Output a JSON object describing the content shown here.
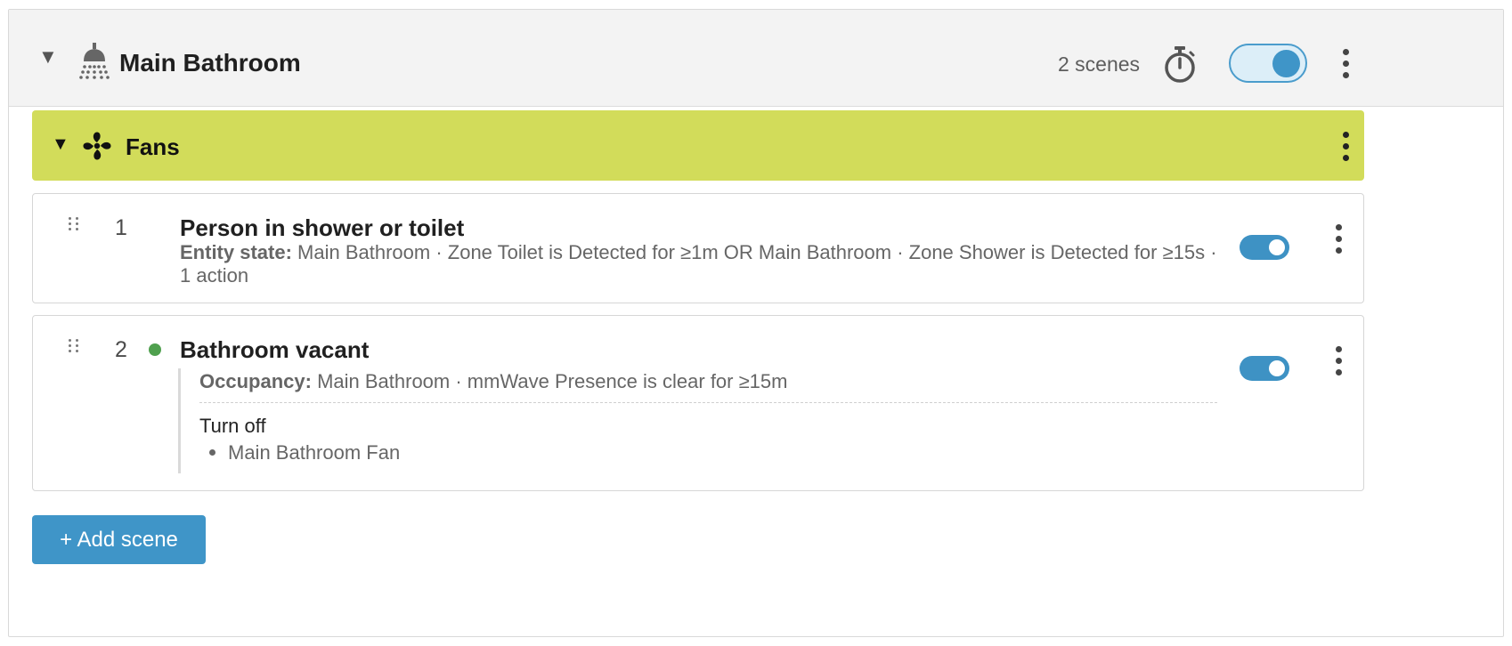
{
  "room": {
    "title": "Main Bathroom",
    "scene_count": "2 scenes",
    "enabled": true
  },
  "group": {
    "title": "Fans",
    "color": "#d2dc5a"
  },
  "scenes": [
    {
      "number": "1",
      "name": "Person in shower or toilet",
      "desc_label": "Entity state:",
      "desc_text": "Main Bathroom · Zone Toilet is Detected for ≥1m OR Main Bathroom · Zone Shower is Detected for ≥15s · 1 action",
      "enabled": true
    },
    {
      "number": "2",
      "name": "Bathroom vacant",
      "status_color": "#4fa04e",
      "condition_label": "Occupancy:",
      "condition_text": "Main Bathroom · mmWave Presence is clear for ≥15m",
      "action_title": "Turn off",
      "action_items": [
        "Main Bathroom Fan"
      ],
      "enabled": true
    }
  ],
  "add_button_label": "+ Add scene",
  "colors": {
    "accent": "#3f95c8",
    "status_green": "#4fa04e"
  }
}
